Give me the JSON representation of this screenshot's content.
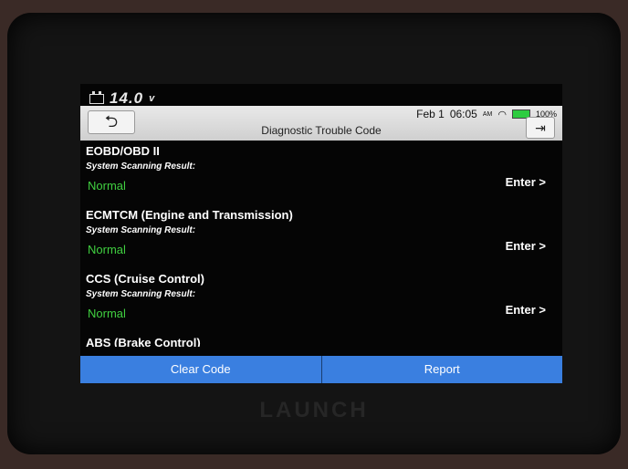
{
  "status": {
    "voltage": "14.0",
    "voltage_unit": "v"
  },
  "header": {
    "title": "Diagnostic Trouble Code",
    "date": "Feb 1",
    "time": "06:05",
    "ampm": "AM",
    "battery_pct": "100%",
    "back_icon": "back-arrow-icon",
    "exit_icon": "exit-icon"
  },
  "results": [
    {
      "name": "EOBD/OBD II",
      "subtitle": "System Scanning Result:",
      "status": "Normal",
      "action": "Enter >"
    },
    {
      "name": "ECMTCM (Engine and Transmission)",
      "subtitle": "System Scanning Result:",
      "status": "Normal",
      "action": "Enter >"
    },
    {
      "name": "CCS (Cruise Control)",
      "subtitle": "System Scanning Result:",
      "status": "Normal",
      "action": "Enter >"
    },
    {
      "name": "ABS (Brake Control)"
    }
  ],
  "buttons": {
    "clear": "Clear Code",
    "report": "Report"
  },
  "device": {
    "brand": "LAUNCH"
  },
  "colors": {
    "status_normal": "#40d040",
    "button_bg": "#3a7fe0"
  }
}
